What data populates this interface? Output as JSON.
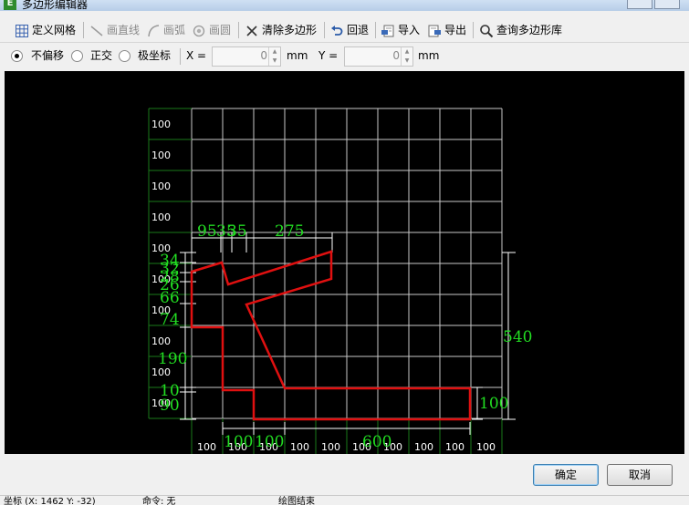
{
  "window": {
    "title": "多边形编辑器"
  },
  "toolbar": {
    "define_grid": "定义网格",
    "draw_line": "画直线",
    "draw_arc": "画弧",
    "draw_circle": "画圆",
    "clear_polygon": "清除多边形",
    "undo": "回退",
    "import": "导入",
    "export": "导出",
    "query_library": "查询多边形库"
  },
  "options": {
    "no_offset": "不偏移",
    "orthogonal": "正交",
    "polar": "极坐标",
    "selected": "不偏移",
    "x_label": "X =",
    "x_value": "0",
    "x_unit": "mm",
    "y_label": "Y =",
    "y_value": "0",
    "y_unit": "mm"
  },
  "grid": {
    "cell_labels": [
      "100",
      "100",
      "100",
      "100",
      "100",
      "100",
      "100",
      "100",
      "100",
      "100"
    ],
    "row_labels": [
      "100",
      "100",
      "100",
      "100",
      "100",
      "100",
      "100",
      "100",
      "100",
      "100"
    ]
  },
  "dimensions": {
    "top": [
      "95",
      "35",
      "35",
      "275"
    ],
    "left": [
      "34",
      "32",
      "28",
      "26",
      "66",
      "74",
      "190",
      "10",
      "90"
    ],
    "bottom": [
      "100",
      "100",
      "600"
    ],
    "right": [
      "540",
      "100"
    ]
  },
  "buttons": {
    "ok": "确定",
    "cancel": "取消"
  },
  "statusbar": {
    "coords": "坐标 (X: 1462 Y: -32)",
    "command": "命令: 无",
    "message": "绘图结束"
  },
  "colors": {
    "grid": "#c8c8c8",
    "canvas": "#000000",
    "polygon": "#e01010",
    "dimension": "#22dd22",
    "label": "#ffffff",
    "guide": "#1a7a1a"
  }
}
